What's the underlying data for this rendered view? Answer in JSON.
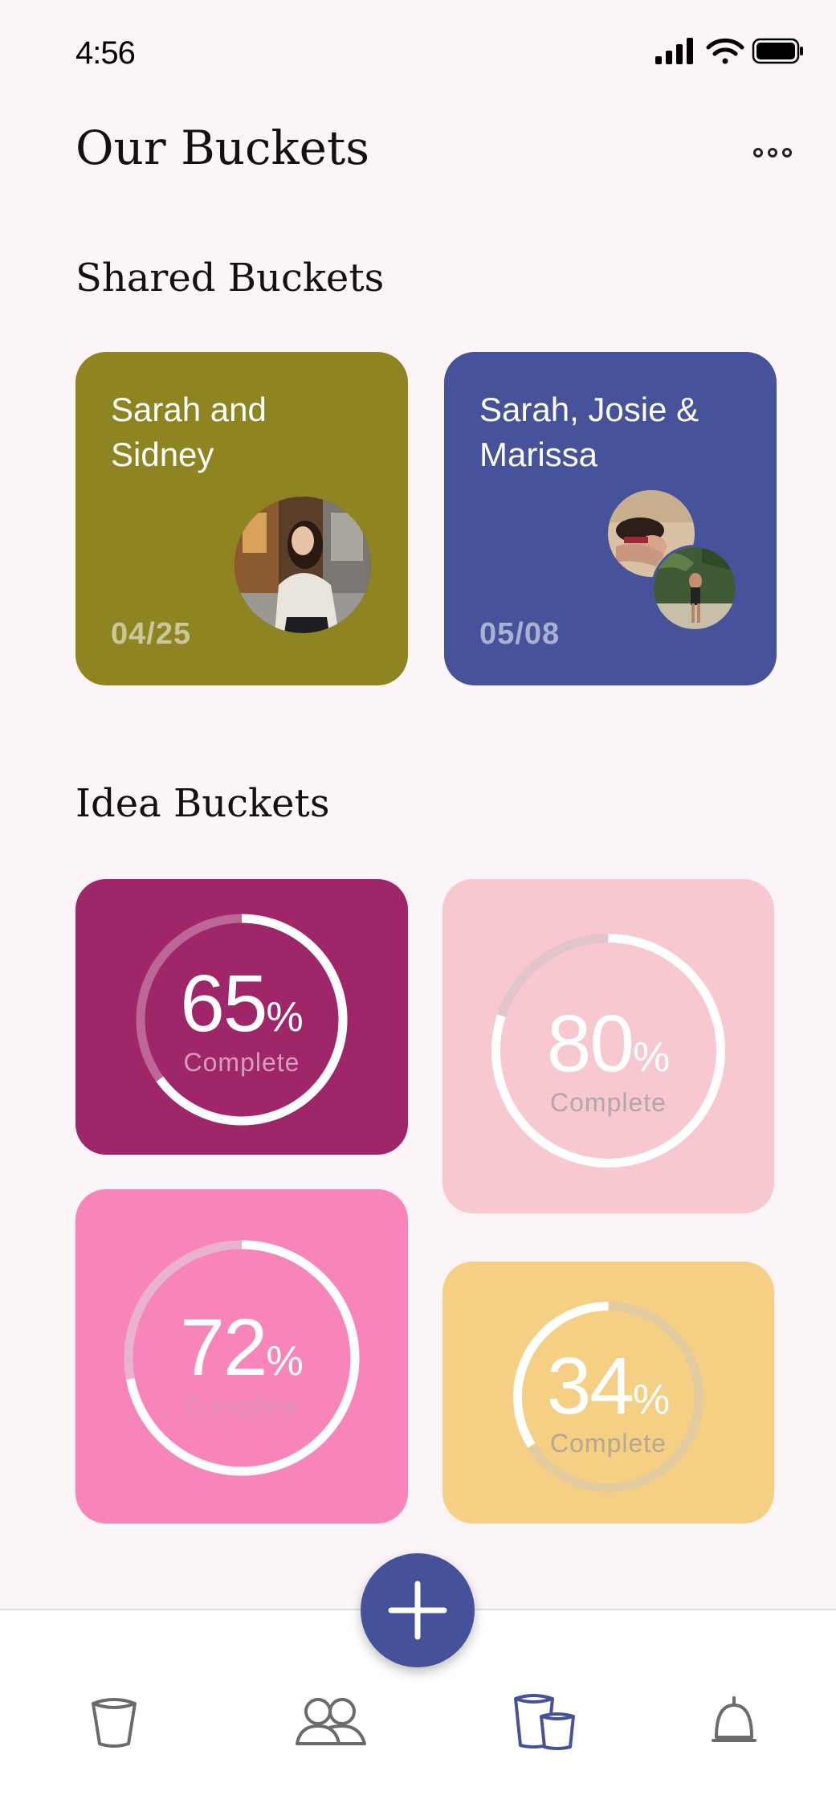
{
  "status_bar": {
    "time": "4:56",
    "icons": [
      "signal-icon",
      "wifi-icon",
      "battery-icon"
    ]
  },
  "header": {
    "title": "Our Buckets",
    "more_icon": "more-icon"
  },
  "shared_section": {
    "title": "Shared Buckets",
    "cards": [
      {
        "name": "Sarah and Sidney",
        "date": "04/25",
        "color": "#8e8421",
        "avatars": [
          "photo-avatar"
        ]
      },
      {
        "name": "Sarah, Josie & Marissa",
        "date": "05/08",
        "color": "#46529a",
        "avatars": [
          "photo-avatar",
          "photo-avatar"
        ]
      }
    ]
  },
  "idea_section": {
    "title": "Idea Buckets",
    "cards": [
      {
        "percent": "65",
        "percent_value": 65,
        "sign": "%",
        "label": "Complete",
        "color": "#a0266a"
      },
      {
        "percent": "80",
        "percent_value": 80,
        "sign": "%",
        "label": "Complete",
        "color": "#f8c8d1"
      },
      {
        "percent": "72",
        "percent_value": 72,
        "sign": "%",
        "label": "Complete",
        "color": "#f785b9"
      },
      {
        "percent": "34",
        "percent_value": 34,
        "sign": "%",
        "label": "Complete",
        "color": "#f5cf84"
      }
    ]
  },
  "fab": {
    "icon": "plus-icon"
  },
  "bottom_nav": {
    "items": [
      {
        "icon": "bucket-icon",
        "active": false
      },
      {
        "icon": "friends-icon",
        "active": false
      },
      {
        "icon": "buckets-icon",
        "active": true
      },
      {
        "icon": "bell-icon",
        "active": false
      }
    ]
  },
  "colors": {
    "background": "#fcf5f8",
    "accent": "#45529a",
    "nav_inactive": "#6b6b6b"
  }
}
